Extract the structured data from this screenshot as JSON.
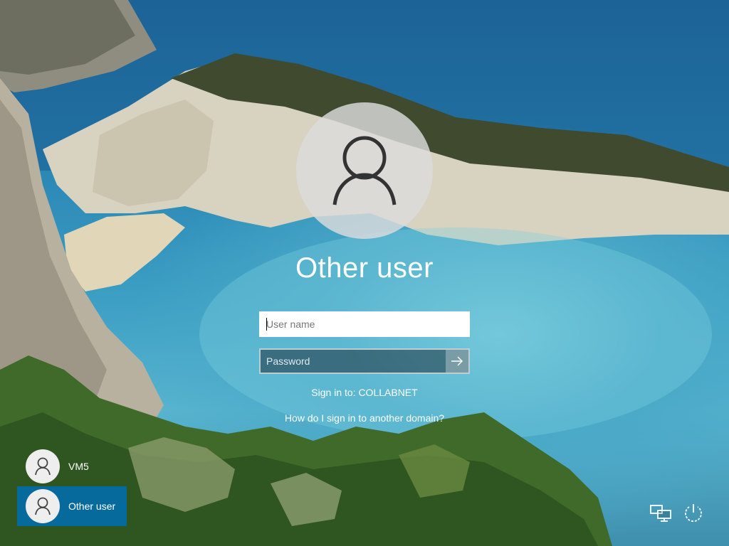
{
  "login": {
    "title": "Other user",
    "username_placeholder": "User name",
    "password_placeholder": "Password",
    "sign_in_to": "Sign in to: COLLABNET",
    "domain_help_link": "How do I sign in to another domain?"
  },
  "user_list": [
    {
      "name": "VM5",
      "selected": false
    },
    {
      "name": "Other user",
      "selected": true
    }
  ],
  "icons": {
    "large_avatar": "user-icon",
    "submit": "arrow-right-icon",
    "network": "network-icon",
    "power": "power-icon"
  },
  "colors": {
    "selected_tile": "#006eb4",
    "text": "#ffffff"
  }
}
